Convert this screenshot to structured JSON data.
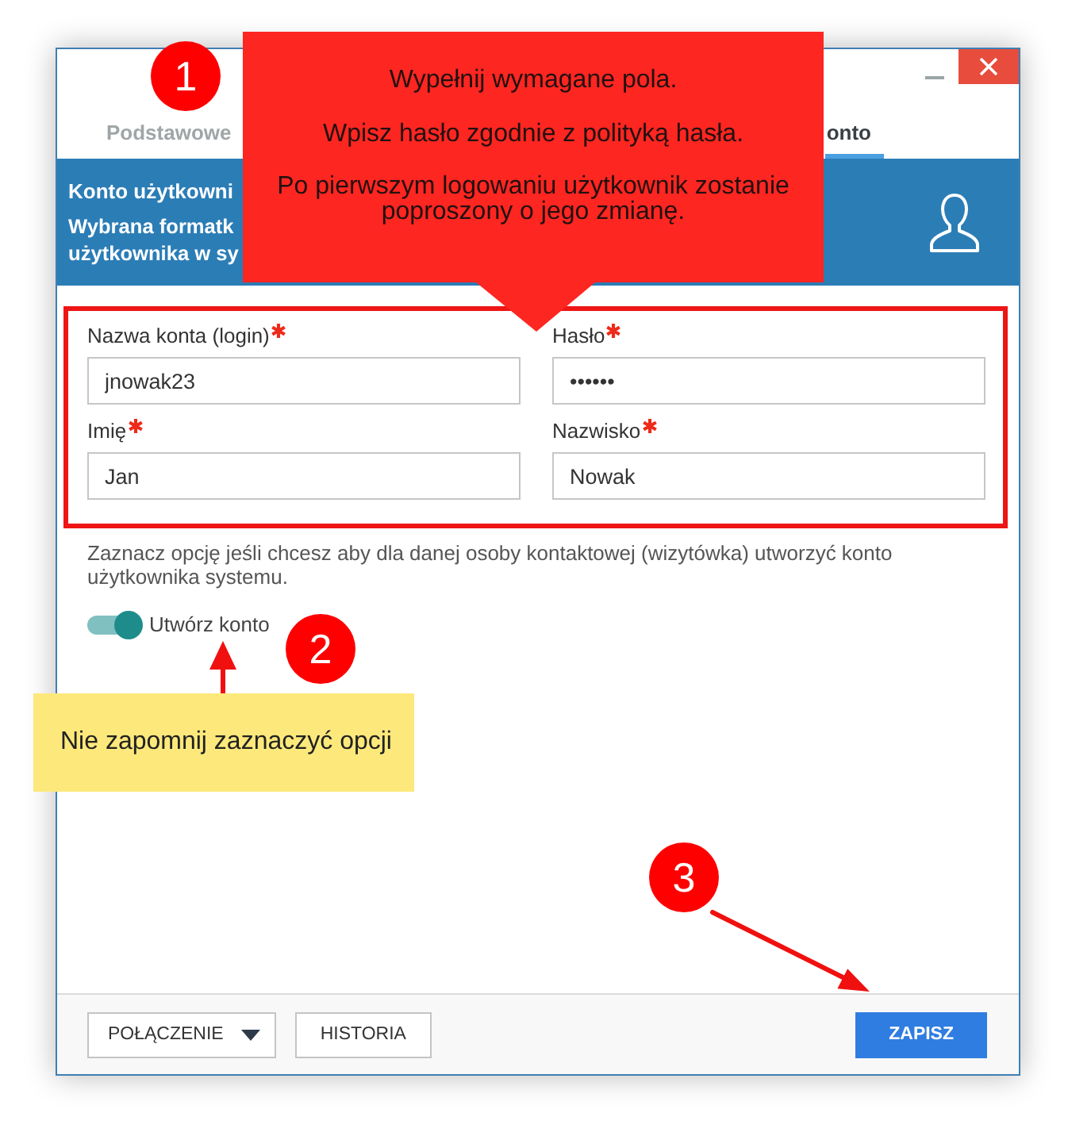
{
  "window": {
    "tabs": [
      {
        "label": "Podstawowe",
        "selected": false
      },
      {
        "label": "onto",
        "selected": true
      }
    ]
  },
  "header": {
    "title": "Konto użytkowni",
    "lines": [
      "Wybrana formatk",
      "użytkownika w sy"
    ]
  },
  "form": {
    "fields": [
      {
        "label": "Nazwa konta (login)",
        "required": true,
        "value": "jnowak23"
      },
      {
        "label": "Hasło",
        "required": true,
        "value": "••••••"
      },
      {
        "label": "Imię",
        "required": true,
        "value": "Jan"
      },
      {
        "label": "Nazwisko",
        "required": true,
        "value": "Nowak"
      }
    ]
  },
  "hint": "Zaznacz opcję jeśli chcesz aby dla danej osoby kontaktowej (wizytówka) utworzyć konto użytkownika systemu.",
  "toggle": {
    "label": "Utwórz konto",
    "on": true
  },
  "footer": {
    "buttons": [
      {
        "label": "POŁĄCZENIE",
        "kind": "dropdown"
      },
      {
        "label": "HISTORIA",
        "kind": "default"
      },
      {
        "label": "ZAPISZ",
        "kind": "primary"
      }
    ]
  },
  "annotations": {
    "callout": [
      "Wypełnij wymagane pola.",
      "Wpisz hasło zgodnie z polityką hasła.",
      "Po pierwszym logowaniu użytkownik zostanie poproszony o jego zmianę."
    ],
    "steps": [
      "1",
      "2",
      "3"
    ],
    "note": "Nie zapomnij zaznaczyć opcji"
  }
}
